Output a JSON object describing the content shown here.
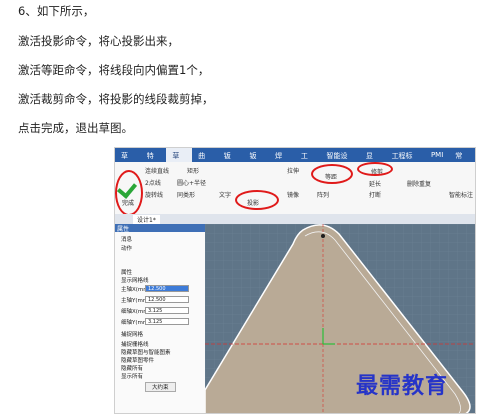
{
  "instructions": [
    "6、如下所示，",
    "激活投影命令，将心投影出来，",
    "激活等距命令，将线段向内偏置1个，",
    "激活裁剪命令，将投影的线段裁剪掉，",
    "点击完成，退出草图。"
  ],
  "app": {
    "menu_tabs": [
      "草图",
      "特征",
      "草图",
      "曲面",
      "钣金",
      "钣金",
      "焊接",
      "工具",
      "智能设计",
      "显示",
      "工程标注",
      "PMI",
      "常用"
    ],
    "active_tab_index": 2,
    "ribbon": {
      "finish_label": "完成",
      "finish_group": "草图",
      "draw_items": [
        "连续直线",
        "矩形",
        "2点线",
        "圆心+半径",
        "投影",
        "旋转线",
        "同类形",
        "文字"
      ],
      "edit_items": [
        "拉伸",
        "修剪",
        "等距",
        "延长",
        "复制",
        "打断",
        "镜像",
        "阵列",
        "删除重复",
        "偏移"
      ],
      "group_labels": [
        "绘制",
        "修改"
      ],
      "project_label": "投影",
      "offset_label": "等距",
      "trim_label": "修剪",
      "smart_label": "智能标注"
    },
    "doc_tab": "设计1*",
    "panel": {
      "title": "属性",
      "items": [
        "消息",
        "动作",
        "属性",
        "显示网格线"
      ],
      "fields": [
        {
          "label": "主轴X(mm)",
          "value": "12.500"
        },
        {
          "label": "主轴Y(mm)",
          "value": "12.500"
        },
        {
          "label": "细轴X(mm)",
          "value": "3.125"
        },
        {
          "label": "细轴Y(mm)",
          "value": "3.125"
        }
      ],
      "options": [
        "捕捉网格",
        "捕捉栅格线",
        "隐藏草图与智能图素",
        "隐藏草图零件",
        "隐藏所有",
        "显示所有"
      ],
      "button": "大约束"
    }
  },
  "watermark": "最需教育",
  "colors": {
    "highlight": "#e01a1a",
    "watermark": "#2634c8",
    "menubar": "#2a5ea8"
  }
}
